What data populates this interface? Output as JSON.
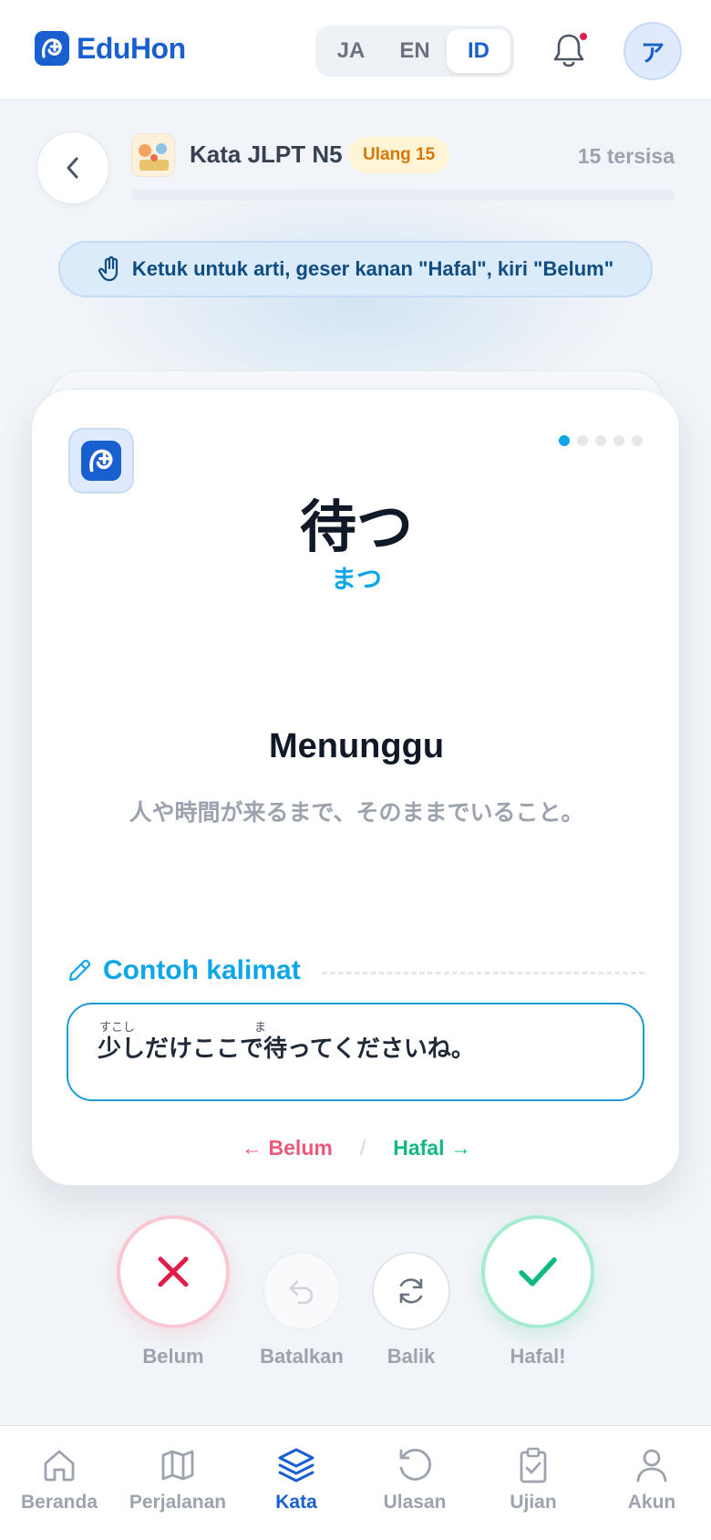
{
  "app": {
    "name": "EduHon"
  },
  "header": {
    "languages": [
      {
        "code": "JA",
        "active": false
      },
      {
        "code": "EN",
        "active": false
      },
      {
        "code": "ID",
        "active": true
      }
    ],
    "avatar_initial": "ア",
    "has_notification": true
  },
  "deck": {
    "title": "Kata JLPT N5",
    "badge": "Ulang 15",
    "remaining": "15 tersisa",
    "progress": 0
  },
  "hint": {
    "text": "Ketuk untuk arti, geser kanan \"Hafal\", kiri \"Belum\""
  },
  "card": {
    "word": "待つ",
    "reading": "まつ",
    "meaning": "Menunggu",
    "definition": "人や時間が来るまで、そのままでいること。",
    "page_dots": 5,
    "active_dot": 0,
    "example_title": "Contoh kalimat",
    "example_sentence": "少しだけここで待ってくださいね。",
    "example_ruby_1": "すこし",
    "example_ruby_2": "ま",
    "swipe_left": "← Belum",
    "swipe_sep": "/",
    "swipe_right": "Hafal →"
  },
  "actions": {
    "no_label": "Belum",
    "undo_label": "Batalkan",
    "flip_label": "Balik",
    "yes_label": "Hafal!"
  },
  "nav": {
    "items": [
      {
        "label": "Beranda",
        "icon": "home-icon",
        "active": false
      },
      {
        "label": "Perjalanan",
        "icon": "map-icon",
        "active": false
      },
      {
        "label": "Kata",
        "icon": "layers-icon",
        "active": true
      },
      {
        "label": "Ulasan",
        "icon": "history-icon",
        "active": false
      },
      {
        "label": "Ujian",
        "icon": "clipboard-check-icon",
        "active": false
      },
      {
        "label": "Akun",
        "icon": "user-icon",
        "active": false
      }
    ]
  },
  "colors": {
    "brand": "#1a5fd0",
    "accent": "#0ea5e9",
    "danger": "#e11d48",
    "success": "#10b981"
  }
}
